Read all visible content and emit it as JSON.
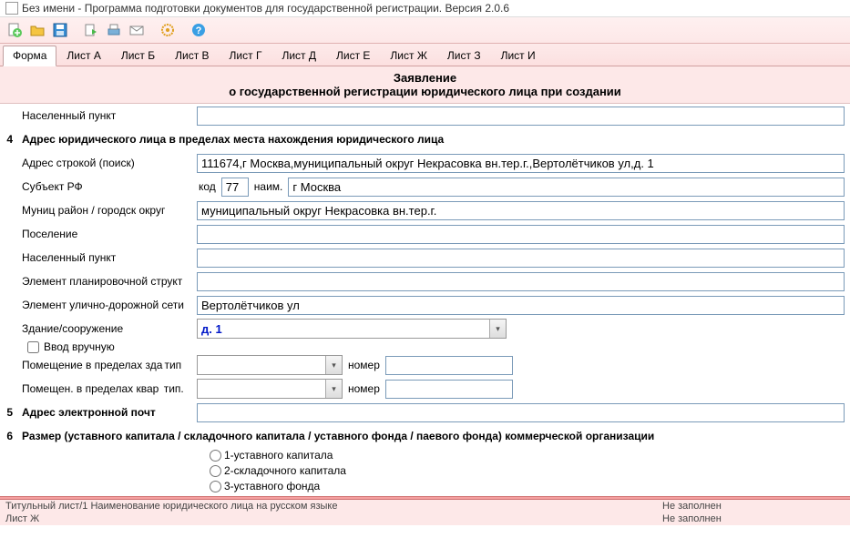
{
  "window": {
    "title": "Без имени - Программа подготовки документов для государственной регистрации. Версия 2.0.6"
  },
  "tabs": [
    "Форма",
    "Лист А",
    "Лист Б",
    "Лист В",
    "Лист Г",
    "Лист Д",
    "Лист Е",
    "Лист Ж",
    "Лист З",
    "Лист И"
  ],
  "active_tab": 0,
  "header": {
    "line1": "Заявление",
    "line2": "о государственной регистрации юридического лица при создании"
  },
  "fields": {
    "locality0": {
      "label": "Населенный пункт",
      "value": ""
    },
    "sec4": {
      "num": "4",
      "label": "Адрес юридического лица в пределах места нахождения юридического лица"
    },
    "addr_search": {
      "label": "Адрес строкой (поиск)",
      "value": "111674,г Москва,муниципальный округ Некрасовка вн.тер.г.,Вертолётчиков ул,д. 1"
    },
    "subject": {
      "label": "Субъект РФ",
      "code_lbl": "код",
      "code": "77",
      "name_lbl": "наим.",
      "name": "г Москва"
    },
    "munic": {
      "label": "Муниц район / городск округ",
      "value": "муниципальный округ Некрасовка вн.тер.г."
    },
    "settlement": {
      "label": "Поселение",
      "value": ""
    },
    "locality": {
      "label": "Населенный пункт",
      "value": ""
    },
    "plan_struct": {
      "label": "Элемент планировочной структ",
      "value": ""
    },
    "street": {
      "label": "Элемент улично-дорожной сети",
      "value": "Вертолётчиков ул"
    },
    "building": {
      "label": "Здание/сооружение",
      "value": "д. 1",
      "manual": "Ввод вручную"
    },
    "room_bld": {
      "label": "Помещение в пределах зда",
      "type_lbl": "тип",
      "type": "",
      "num_lbl": "номер",
      "num": ""
    },
    "room_flat": {
      "label": "Помещен. в пределах квар",
      "type_lbl": "тип.",
      "type": "",
      "num_lbl": "номер",
      "num": ""
    },
    "sec5": {
      "num": "5",
      "label": "Адрес электронной почт"
    },
    "sec6": {
      "num": "6",
      "label": "Размер (уставного капитала / складочного капитала / уставного фонда  / паевого фонда)  коммерческой организации"
    },
    "radios": [
      "1-уставного капитала",
      "2-складочного капитала",
      "3-уставного фонда"
    ]
  },
  "status": [
    {
      "left": "Титульный лист/1 Наименование юридического лица на русском языке",
      "right": "Не заполнен"
    },
    {
      "left": "Лист Ж",
      "right": "Не заполнен"
    }
  ],
  "icons": {
    "new": "#2eb82e",
    "open": "#e6a817",
    "save": "#2a7fd4",
    "export": "#3a9a3a",
    "print": "#4aa0d0",
    "mail": "#888",
    "gear": "#e0a020",
    "help": "#2a7fd4"
  }
}
